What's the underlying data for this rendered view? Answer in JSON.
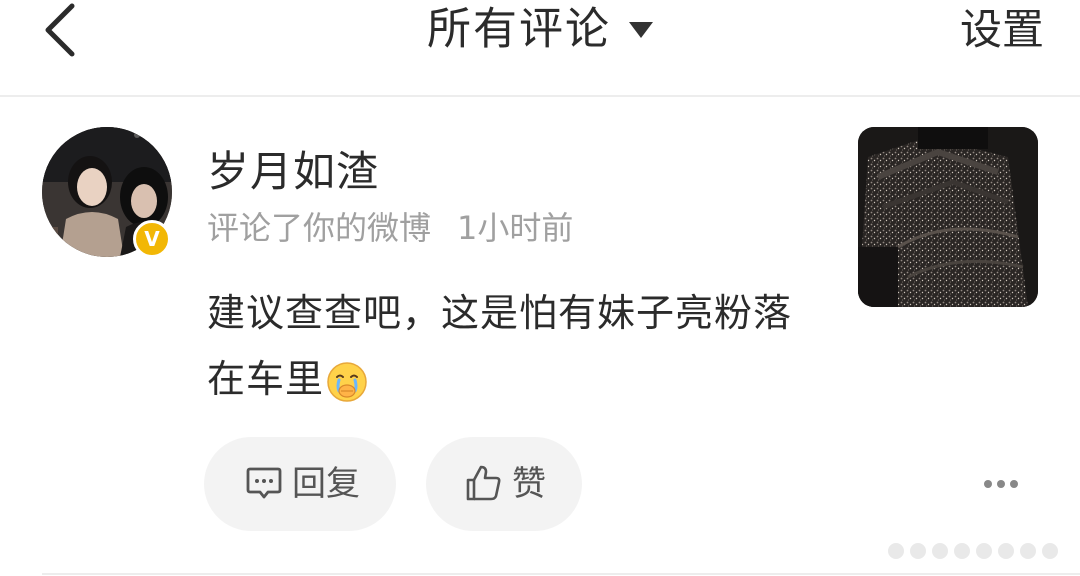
{
  "header": {
    "back_icon": "chevron-left-icon",
    "title": "所有评论",
    "title_dropdown_icon": "caret-down-icon",
    "settings_label": "设置"
  },
  "notification": {
    "username": "岁月如渣",
    "verified_badge": "V",
    "verified_color": "#f2b705",
    "action_text": "评论了你的微博",
    "time_text": "1小时前",
    "comment_text": "建议查查吧，这是怕有妹子亮粉落在车里",
    "comment_emoji": "crying-face-icon",
    "thumbnail": "car-interior-floor-mat-image"
  },
  "actions": {
    "reply_label": "回复",
    "reply_icon": "comment-icon",
    "like_label": "赞",
    "like_icon": "thumbs-up-icon",
    "more_icon": "more-dots-icon"
  }
}
